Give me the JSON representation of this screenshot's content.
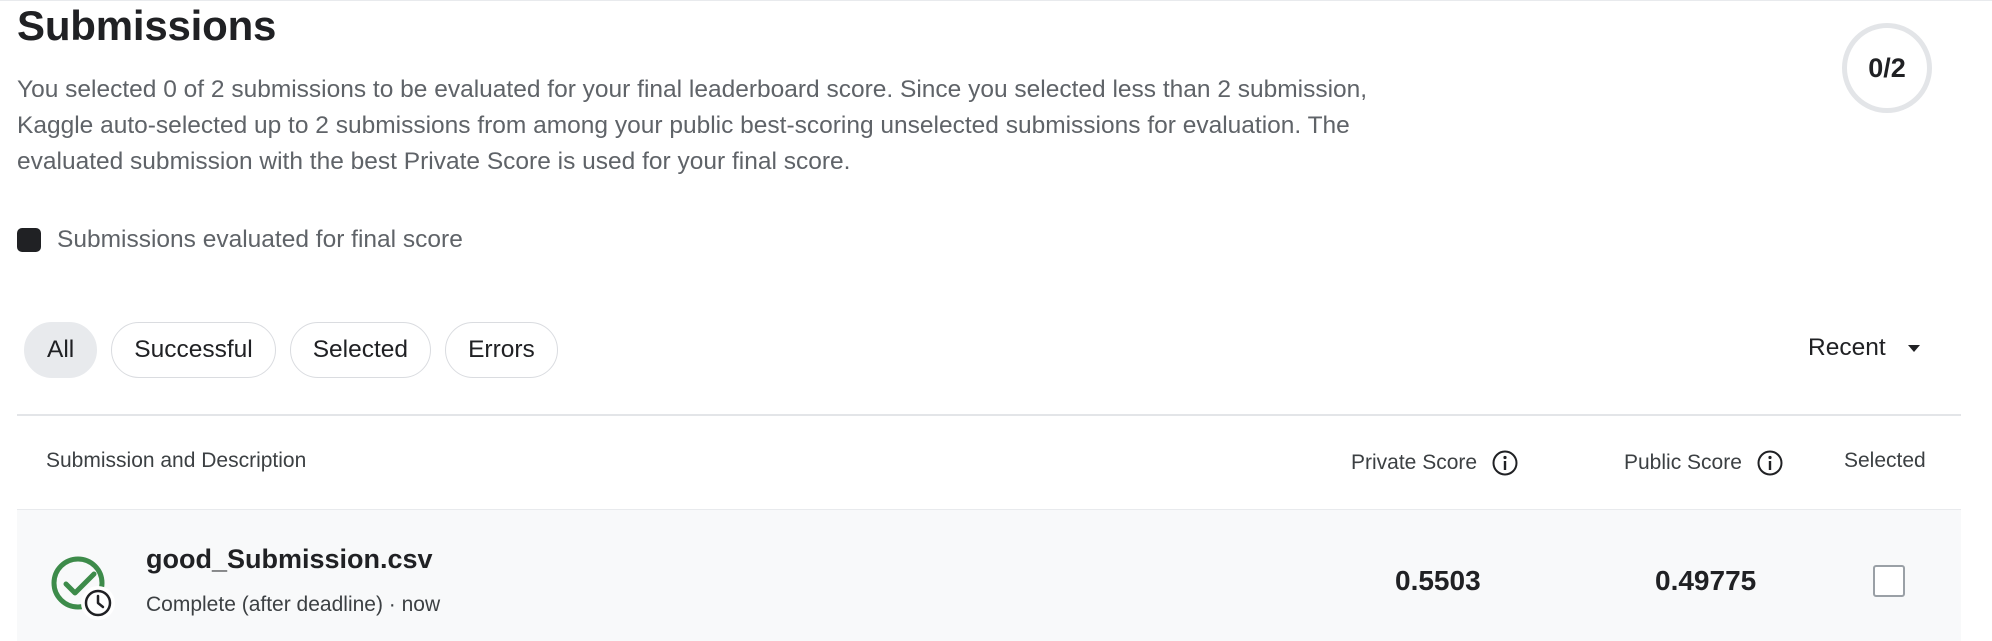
{
  "header": {
    "title": "Submissions",
    "description": "You selected 0 of 2 submissions to be evaluated for your final leaderboard score. Since you selected less than 2 submission, Kaggle auto-selected up to 2 submissions from among your public best-scoring unselected submissions for evaluation. The evaluated submission with the best Private Score is used for your final score.",
    "selection_counter": "0/2"
  },
  "legend": {
    "label": "Submissions evaluated for final score",
    "swatch_color": "#202124"
  },
  "filters": {
    "chips": [
      {
        "label": "All",
        "active": true
      },
      {
        "label": "Successful",
        "active": false
      },
      {
        "label": "Selected",
        "active": false
      },
      {
        "label": "Errors",
        "active": false
      }
    ],
    "sort_label": "Recent",
    "sort_icon": "caret-down-icon"
  },
  "table": {
    "columns": {
      "submission": "Submission and Description",
      "private_score": "Private Score",
      "public_score": "Public Score",
      "selected": "Selected"
    },
    "rows": [
      {
        "file_name": "good_Submission.csv",
        "status_text": "Complete (after deadline) · now",
        "status_icon": "complete-late-icon",
        "private_score": "0.5503",
        "public_score": "0.49775",
        "selected": false
      }
    ]
  },
  "colors": {
    "success_green": "#3d8b4a",
    "text": "#202124",
    "muted": "#5f6368"
  }
}
